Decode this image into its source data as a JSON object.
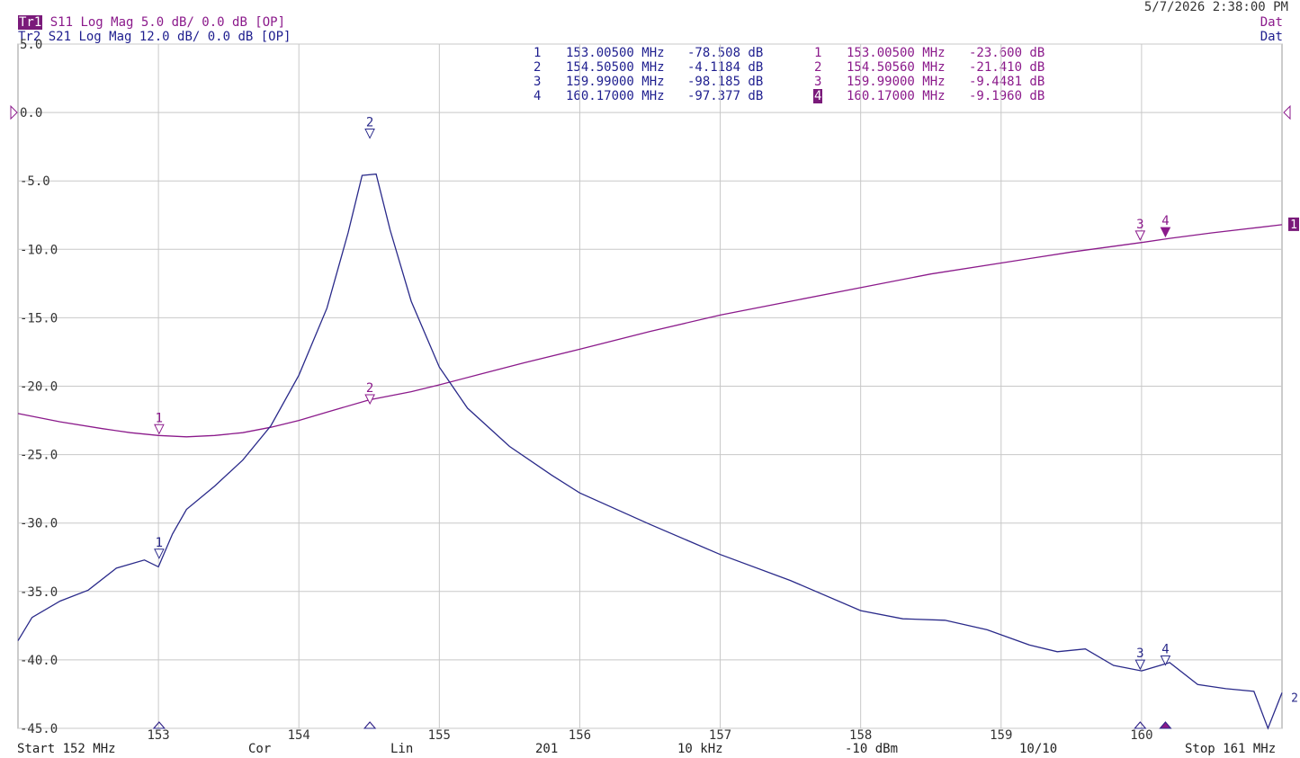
{
  "header": {
    "tr1_tag": "Tr1",
    "tr1_text": "S11 Log Mag 5.0 dB/ 0.0 dB [OP]",
    "tr2_tag": "Tr2",
    "tr2_text": "S21 Log Mag 12.0 dB/ 0.0 dB [OP]",
    "datetime": "5/7/2026 2:38:00 PM",
    "dat1": "Dat",
    "dat2": "Dat"
  },
  "marker_table_s21": [
    {
      "num": "1",
      "freq": "153.00500 MHz",
      "value": "-78.508 dB"
    },
    {
      "num": "2",
      "freq": "154.50500 MHz",
      "value": "-4.1184 dB"
    },
    {
      "num": "3",
      "freq": "159.99000 MHz",
      "value": "-98.185 dB"
    },
    {
      "num": "4",
      "freq": "160.17000 MHz",
      "value": "-97.377 dB"
    }
  ],
  "marker_table_s11": [
    {
      "num": "1",
      "freq": "153.00500 MHz",
      "value": "-23.600 dB"
    },
    {
      "num": "2",
      "freq": "154.50560 MHz",
      "value": "-21.410 dB"
    },
    {
      "num": "3",
      "freq": "159.99000 MHz",
      "value": "-9.4481 dB"
    },
    {
      "num": "4",
      "freq": "160.17000 MHz",
      "value": "-9.1960 dB",
      "active": true
    }
  ],
  "footer": {
    "start": "Start 152 MHz",
    "cor": "Cor",
    "lin": "Lin",
    "points": "201",
    "ifbw": "10 kHz",
    "power": "-10 dBm",
    "avg": "10/10",
    "stop": "Stop 161 MHz"
  },
  "right_labels": {
    "trace1": "1",
    "trace2": "2"
  },
  "colors": {
    "s11": "#8b1a8b",
    "s21": "#2a2a8a",
    "grid": "#c8c8c8",
    "active": "#7a1a7a"
  },
  "chart_data": {
    "type": "line",
    "xlim": [
      152,
      161
    ],
    "ylim": [
      -45,
      5
    ],
    "x_ticks": [
      153,
      154,
      155,
      156,
      157,
      158,
      159,
      160
    ],
    "y_ticks": [
      5.0,
      0.0,
      -5.0,
      -10.0,
      -15.0,
      -20.0,
      -25.0,
      -30.0,
      -35.0,
      -40.0,
      -45.0
    ],
    "y_tick_labels": [
      "5.0",
      "0.0",
      "-5.0",
      "-10.0",
      "-15.0",
      "-20.0",
      "-25.0",
      "-30.0",
      "-35.0",
      "-40.0",
      "-45.0"
    ],
    "x_unit": "MHz",
    "y_unit": "dB",
    "series": [
      {
        "name": "S11",
        "x": [
          152.0,
          152.3,
          152.6,
          152.8,
          153.0,
          153.2,
          153.4,
          153.6,
          153.8,
          154.0,
          154.2,
          154.5,
          154.8,
          155.0,
          155.3,
          155.6,
          156.0,
          156.5,
          157.0,
          157.5,
          158.0,
          158.5,
          159.0,
          159.5,
          160.0,
          160.2,
          160.5,
          161.0
        ],
        "y": [
          -22.0,
          -22.6,
          -23.1,
          -23.4,
          -23.6,
          -23.7,
          -23.6,
          -23.4,
          -23.0,
          -22.5,
          -21.9,
          -21.0,
          -20.4,
          -19.9,
          -19.1,
          -18.3,
          -17.3,
          -16.0,
          -14.8,
          -13.8,
          -12.8,
          -11.8,
          -11.0,
          -10.2,
          -9.5,
          -9.2,
          -8.8,
          -8.2
        ]
      },
      {
        "name": "S21",
        "x": [
          152.0,
          152.1,
          152.3,
          152.5,
          152.7,
          152.9,
          153.0,
          153.1,
          153.2,
          153.4,
          153.6,
          153.8,
          154.0,
          154.2,
          154.35,
          154.45,
          154.55,
          154.65,
          154.8,
          155.0,
          155.2,
          155.5,
          155.8,
          156.0,
          156.5,
          157.0,
          157.5,
          158.0,
          158.3,
          158.6,
          158.9,
          159.2,
          159.4,
          159.6,
          159.8,
          160.0,
          160.2,
          160.4,
          160.6,
          160.8,
          160.9,
          161.0
        ],
        "y": [
          -38.6,
          -36.9,
          -35.7,
          -34.9,
          -33.3,
          -32.7,
          -33.2,
          -30.8,
          -29.0,
          -27.3,
          -25.4,
          -22.9,
          -19.2,
          -14.3,
          -8.8,
          -4.6,
          -4.5,
          -8.6,
          -13.8,
          -18.6,
          -21.6,
          -24.4,
          -26.5,
          -27.8,
          -30.1,
          -32.3,
          -34.2,
          -36.4,
          -37.0,
          -37.1,
          -37.8,
          -38.9,
          -39.4,
          -39.2,
          -40.4,
          -40.8,
          -40.2,
          -41.8,
          -42.1,
          -42.3,
          -45.0,
          -42.4
        ]
      }
    ],
    "markers_s11": [
      {
        "label": "1",
        "x": 153.005,
        "y": -23.6
      },
      {
        "label": "2",
        "x": 154.5056,
        "y": -21.41
      },
      {
        "label": "3",
        "x": 159.99,
        "y": -9.4481
      },
      {
        "label": "4",
        "x": 160.17,
        "y": -9.196,
        "active": true
      }
    ],
    "markers_s21": [
      {
        "label": "1",
        "x": 153.005,
        "y": -32.7
      },
      {
        "label": "2",
        "x": 154.505,
        "y": -2.0
      },
      {
        "label": "3",
        "x": 159.99,
        "y": -40.8
      },
      {
        "label": "4",
        "x": 160.17,
        "y": -40.5
      }
    ]
  }
}
